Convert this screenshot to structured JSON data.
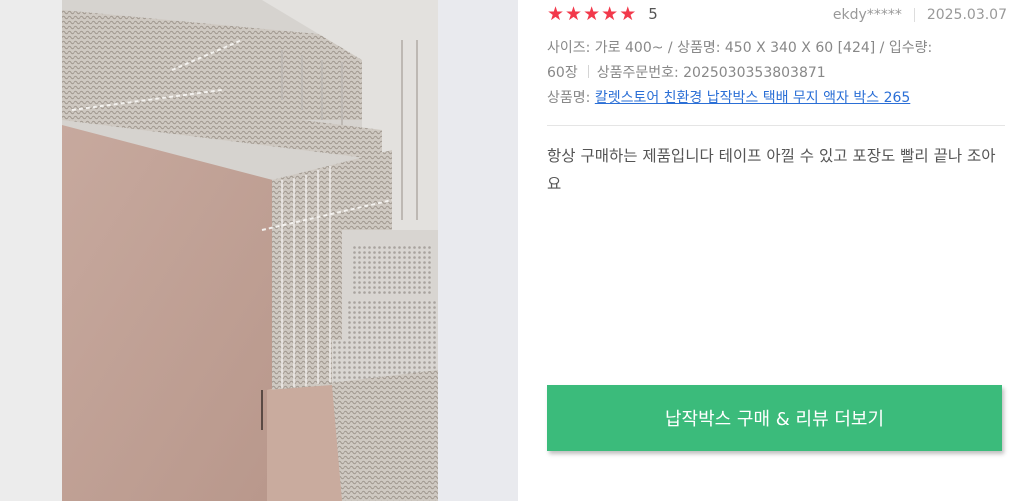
{
  "review": {
    "rating": "5",
    "rating_value": 5,
    "rating_max": 5,
    "star_icon": "★",
    "star_color": "#f2394b",
    "author": "ekdy*****",
    "date": "2025.03.07",
    "options": {
      "line1": "사이즈: 가로 400~ / 상품명: 450 X 340 X 60 [424] / 입수량:",
      "line2_a": "60장",
      "line2_b": "상품주문번호: 2025030353803871",
      "product_label": "상품명: ",
      "product_link": "칼렛스토어 친환경 납작박스 택배 무지 액자 박스 265"
    },
    "content": "항상 구매하는 제품입니다 테이프 아낄 수 있고 포장도 빨리 끝나 조아요"
  },
  "cta": {
    "label": "납작박스 구매 & 리뷰 더보기",
    "color": "#3bbb7b"
  },
  "photo": {
    "icon": "flat-cardboard-boxes-photo"
  }
}
